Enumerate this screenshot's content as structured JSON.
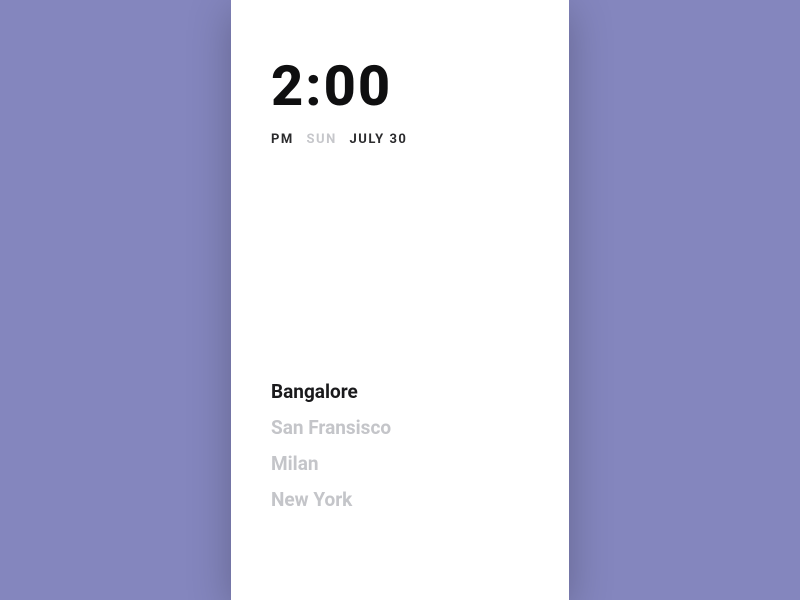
{
  "clock": {
    "time": "2:00",
    "ampm": "PM",
    "day_of_week": "SUN",
    "date": "JULY 30"
  },
  "cities": [
    {
      "name": "Bangalore",
      "active": true
    },
    {
      "name": "San Fransisco",
      "active": false
    },
    {
      "name": "Milan",
      "active": false
    },
    {
      "name": "New York",
      "active": false
    }
  ]
}
